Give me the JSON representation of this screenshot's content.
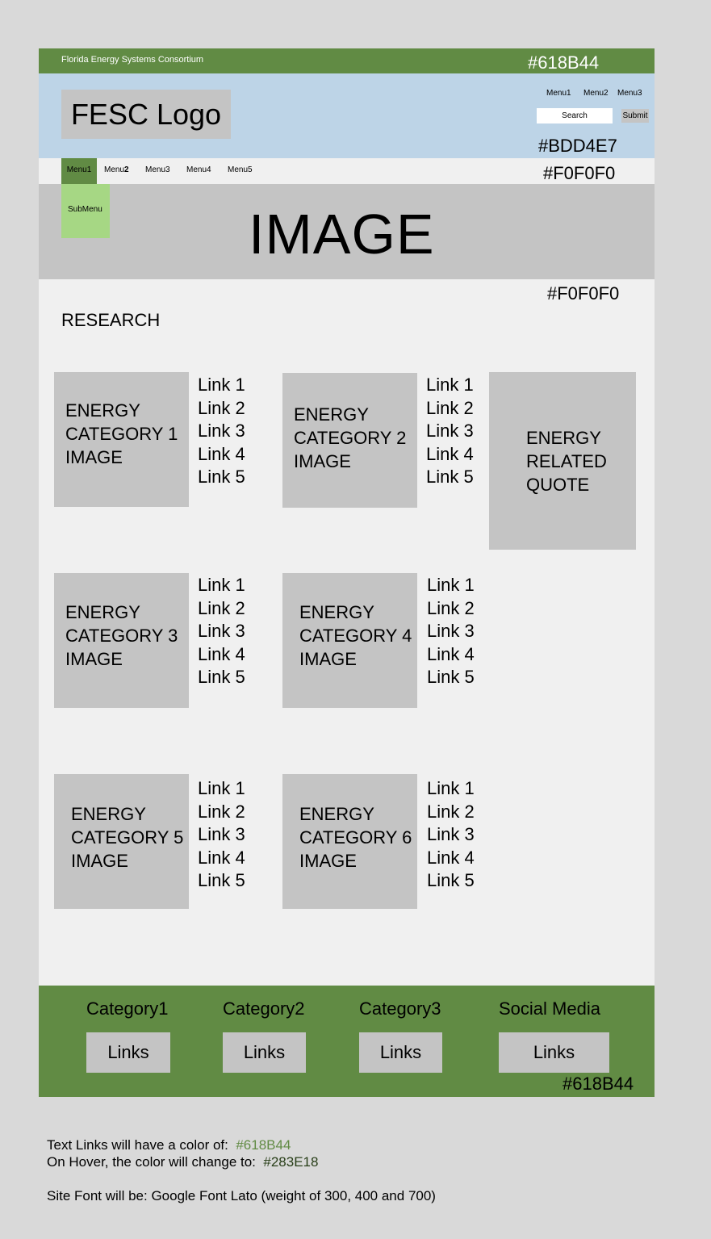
{
  "topbar": {
    "site_name": "Florida Energy Systems Consortium",
    "color_label": "#618B44"
  },
  "header": {
    "logo": "FESC Logo",
    "menu": [
      "Menu1",
      "Menu2",
      "Menu3"
    ],
    "search_placeholder": "Search",
    "submit_label": "Submit",
    "color_label": "#BDD4E7"
  },
  "nav": {
    "items": [
      "Menu1",
      "Menu",
      "Menu3",
      "Menu4",
      "Menu5"
    ],
    "item2_bold": "2",
    "color_label": "#F0F0F0"
  },
  "hero": {
    "image_label": "IMAGE",
    "submenu_label": "SubMenu"
  },
  "main": {
    "color_label": "#F0F0F0",
    "section_title": "RESEARCH",
    "categories": [
      {
        "lines": [
          "ENERGY",
          "CATEGORY 1",
          "IMAGE"
        ],
        "links": [
          "Link 1",
          "Link 2",
          "Link 3",
          "Link 4",
          "Link 5"
        ]
      },
      {
        "lines": [
          "ENERGY",
          "CATEGORY 2",
          "IMAGE"
        ],
        "links": [
          "Link 1",
          "Link 2",
          "Link 3",
          "Link 4",
          "Link 5"
        ]
      },
      {
        "lines": [
          "ENERGY",
          "CATEGORY 3",
          "IMAGE"
        ],
        "links": [
          "Link 1",
          "Link 2",
          "Link 3",
          "Link 4",
          "Link 5"
        ]
      },
      {
        "lines": [
          "ENERGY",
          "CATEGORY 4",
          "IMAGE"
        ],
        "links": [
          "Link 1",
          "Link 2",
          "Link 3",
          "Link 4",
          "Link 5"
        ]
      },
      {
        "lines": [
          "ENERGY",
          "CATEGORY 5",
          "IMAGE"
        ],
        "links": [
          "Link 1",
          "Link 2",
          "Link 3",
          "Link 4",
          "Link 5"
        ]
      },
      {
        "lines": [
          "ENERGY",
          "CATEGORY 6",
          "IMAGE"
        ],
        "links": [
          "Link 1",
          "Link 2",
          "Link 3",
          "Link 4",
          "Link 5"
        ]
      }
    ],
    "quote_lines": [
      "ENERGY",
      "RELATED",
      "QUOTE"
    ]
  },
  "footer": {
    "columns": [
      {
        "title": "Category1",
        "button": "Links"
      },
      {
        "title": "Category2",
        "button": "Links"
      },
      {
        "title": "Category3",
        "button": "Links"
      },
      {
        "title": "Social Media",
        "button": "Links"
      }
    ],
    "color_label": "#618B44"
  },
  "notes": {
    "line1_text": "Text Links will have a color of:",
    "line1_color": "#618B44",
    "line2_text": "On Hover, the color will change to:",
    "line2_color": "#283E18",
    "line3_text": "Site Font will be: Google Font Lato (weight of 300, 400 and 700)"
  }
}
